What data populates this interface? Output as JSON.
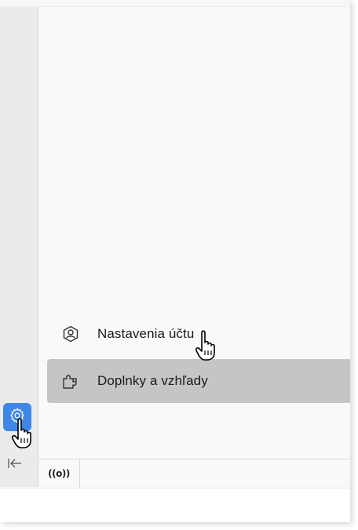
{
  "menu": {
    "items": [
      {
        "id": "account-settings",
        "label": "Nastavenia účtu",
        "icon": "account-shield-icon"
      },
      {
        "id": "addons-themes",
        "label": "Doplnky a vzhľady",
        "icon": "puzzle-icon",
        "highlighted": true
      }
    ]
  },
  "sidebar": {
    "gear_icon": "gear-icon",
    "collapse_icon": "collapse-left-icon"
  },
  "status_bar": {
    "radio_glyph": "((o))"
  },
  "colors": {
    "accent": "#3f86e6",
    "highlight": "#c5c5c5",
    "panel": "#f9f9f9",
    "strip": "#ebebeb"
  }
}
